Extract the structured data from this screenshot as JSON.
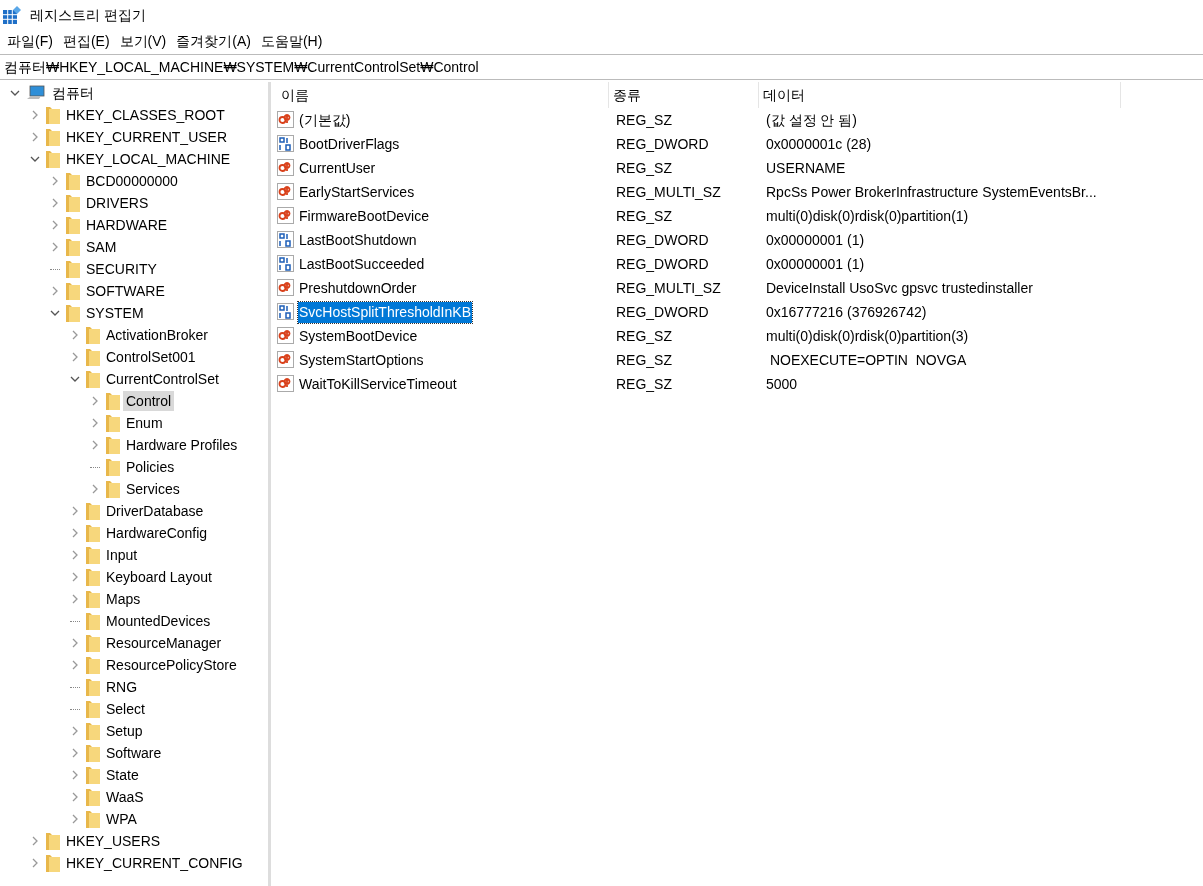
{
  "window": {
    "title": "레지스트리 편집기"
  },
  "menu": [
    "파일(F)",
    "편집(E)",
    "보기(V)",
    "즐겨찾기(A)",
    "도움말(H)"
  ],
  "address": "컴퓨터₩HKEY_LOCAL_MACHINE₩SYSTEM₩CurrentControlSet₩Control",
  "tree": [
    {
      "label": "컴퓨터",
      "kind": "computer",
      "expanded": true,
      "selected": false,
      "children": [
        {
          "label": "HKEY_CLASSES_ROOT",
          "kind": "branch",
          "selected": false
        },
        {
          "label": "HKEY_CURRENT_USER",
          "kind": "branch",
          "selected": false
        },
        {
          "label": "HKEY_LOCAL_MACHINE",
          "kind": "branch",
          "expanded": true,
          "selected": false,
          "children": [
            {
              "label": "BCD00000000",
              "kind": "branch",
              "selected": false
            },
            {
              "label": "DRIVERS",
              "kind": "branch",
              "selected": false
            },
            {
              "label": "HARDWARE",
              "kind": "branch",
              "selected": false
            },
            {
              "label": "SAM",
              "kind": "branch",
              "selected": false
            },
            {
              "label": "SECURITY",
              "kind": "leaf",
              "selected": false
            },
            {
              "label": "SOFTWARE",
              "kind": "branch",
              "selected": false
            },
            {
              "label": "SYSTEM",
              "kind": "branch",
              "expanded": true,
              "selected": false,
              "children": [
                {
                  "label": "ActivationBroker",
                  "kind": "branch",
                  "selected": false
                },
                {
                  "label": "ControlSet001",
                  "kind": "branch",
                  "selected": false
                },
                {
                  "label": "CurrentControlSet",
                  "kind": "branch",
                  "expanded": true,
                  "selected": false,
                  "children": [
                    {
                      "label": "Control",
                      "kind": "branch",
                      "selected": true
                    },
                    {
                      "label": "Enum",
                      "kind": "branch",
                      "selected": false
                    },
                    {
                      "label": "Hardware Profiles",
                      "kind": "branch",
                      "selected": false
                    },
                    {
                      "label": "Policies",
                      "kind": "leaf",
                      "selected": false
                    },
                    {
                      "label": "Services",
                      "kind": "branch",
                      "selected": false
                    }
                  ]
                },
                {
                  "label": "DriverDatabase",
                  "kind": "branch",
                  "selected": false
                },
                {
                  "label": "HardwareConfig",
                  "kind": "branch",
                  "selected": false
                },
                {
                  "label": "Input",
                  "kind": "branch",
                  "selected": false
                },
                {
                  "label": "Keyboard Layout",
                  "kind": "branch",
                  "selected": false
                },
                {
                  "label": "Maps",
                  "kind": "branch",
                  "selected": false
                },
                {
                  "label": "MountedDevices",
                  "kind": "leaf",
                  "selected": false
                },
                {
                  "label": "ResourceManager",
                  "kind": "branch",
                  "selected": false
                },
                {
                  "label": "ResourcePolicyStore",
                  "kind": "branch",
                  "selected": false
                },
                {
                  "label": "RNG",
                  "kind": "leaf",
                  "selected": false
                },
                {
                  "label": "Select",
                  "kind": "leaf",
                  "selected": false
                },
                {
                  "label": "Setup",
                  "kind": "branch",
                  "selected": false
                },
                {
                  "label": "Software",
                  "kind": "branch",
                  "selected": false
                },
                {
                  "label": "State",
                  "kind": "branch",
                  "selected": false
                },
                {
                  "label": "WaaS",
                  "kind": "branch",
                  "selected": false
                },
                {
                  "label": "WPA",
                  "kind": "branch",
                  "selected": false
                }
              ]
            }
          ]
        },
        {
          "label": "HKEY_USERS",
          "kind": "branch",
          "selected": false
        },
        {
          "label": "HKEY_CURRENT_CONFIG",
          "kind": "branch",
          "selected": false
        }
      ]
    }
  ],
  "table": {
    "columns": [
      "이름",
      "종류",
      "데이터"
    ],
    "rows": [
      {
        "kind": "string",
        "name": "(기본값)",
        "type": "REG_SZ",
        "data": "(값 설정 안 됨)",
        "selected": false
      },
      {
        "kind": "binary",
        "name": "BootDriverFlags",
        "type": "REG_DWORD",
        "data": "0x0000001c (28)",
        "selected": false
      },
      {
        "kind": "string",
        "name": "CurrentUser",
        "type": "REG_SZ",
        "data": "USERNAME",
        "selected": false
      },
      {
        "kind": "string",
        "name": "EarlyStartServices",
        "type": "REG_MULTI_SZ",
        "data": "RpcSs Power BrokerInfrastructure SystemEventsBr...",
        "selected": false
      },
      {
        "kind": "string",
        "name": "FirmwareBootDevice",
        "type": "REG_SZ",
        "data": "multi(0)disk(0)rdisk(0)partition(1)",
        "selected": false
      },
      {
        "kind": "binary",
        "name": "LastBootShutdown",
        "type": "REG_DWORD",
        "data": "0x00000001 (1)",
        "selected": false
      },
      {
        "kind": "binary",
        "name": "LastBootSucceeded",
        "type": "REG_DWORD",
        "data": "0x00000001 (1)",
        "selected": false
      },
      {
        "kind": "string",
        "name": "PreshutdownOrder",
        "type": "REG_MULTI_SZ",
        "data": "DeviceInstall UsoSvc gpsvc trustedinstaller",
        "selected": false
      },
      {
        "kind": "binary",
        "name": "SvcHostSplitThresholdInKB",
        "type": "REG_DWORD",
        "data": "0x16777216 (376926742)",
        "selected": true
      },
      {
        "kind": "string",
        "name": "SystemBootDevice",
        "type": "REG_SZ",
        "data": "multi(0)disk(0)rdisk(0)partition(3)",
        "selected": false
      },
      {
        "kind": "string",
        "name": "SystemStartOptions",
        "type": "REG_SZ",
        "data": " NOEXECUTE=OPTIN  NOVGA",
        "selected": false
      },
      {
        "kind": "string",
        "name": "WaitToKillServiceTimeout",
        "type": "REG_SZ",
        "data": "5000",
        "selected": false
      }
    ]
  }
}
